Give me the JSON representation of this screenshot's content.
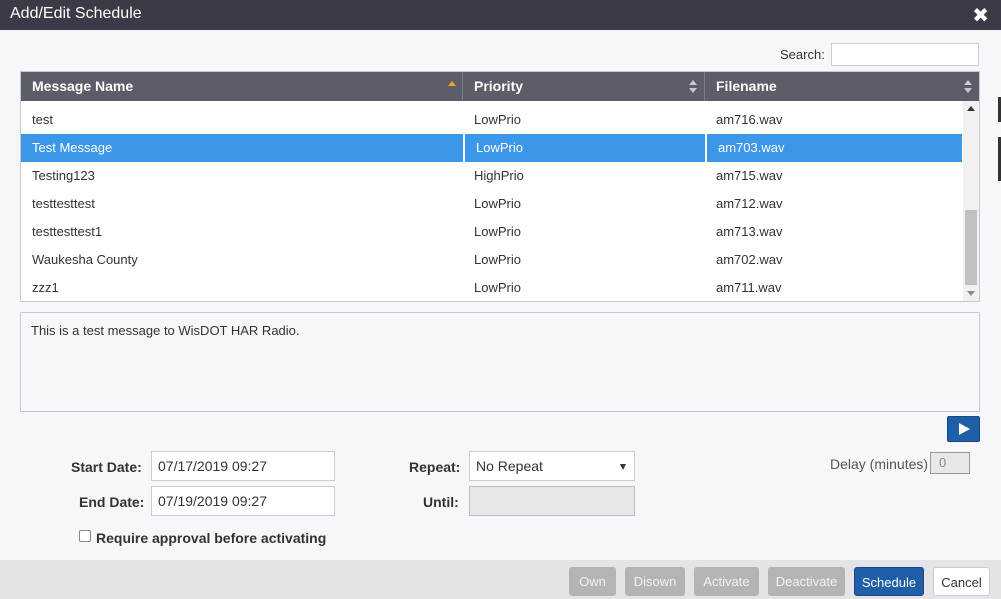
{
  "window": {
    "title": "Add/Edit Schedule"
  },
  "search": {
    "label": "Search:",
    "value": ""
  },
  "table": {
    "columns": [
      "Message Name",
      "Priority",
      "Filename"
    ],
    "rows": [
      {
        "name": "test",
        "priority": "LowPrio",
        "filename": "am716.wav"
      },
      {
        "name": "Test Message",
        "priority": "LowPrio",
        "filename": "am703.wav"
      },
      {
        "name": "Testing123",
        "priority": "HighPrio",
        "filename": "am715.wav"
      },
      {
        "name": "testtesttest",
        "priority": "LowPrio",
        "filename": "am712.wav"
      },
      {
        "name": "testtesttest1",
        "priority": "LowPrio",
        "filename": "am713.wav"
      },
      {
        "name": "Waukesha County",
        "priority": "LowPrio",
        "filename": "am702.wav"
      },
      {
        "name": "zzz1",
        "priority": "LowPrio",
        "filename": "am711.wav"
      }
    ],
    "selected_row": "Test Message"
  },
  "message": {
    "text": "This is a test message to WisDOT HAR Radio."
  },
  "form": {
    "start_date_label": "Start Date:",
    "start_date_value": "07/17/2019 09:27",
    "end_date_label": "End Date:",
    "end_date_value": "07/19/2019 09:27",
    "repeat_label": "Repeat:",
    "repeat_value": "No Repeat",
    "until_label": "Until:",
    "until_value": "",
    "delay_label": "Delay (minutes)",
    "delay_value": "0",
    "approval_label": "Require approval before activating"
  },
  "footer": {
    "own": "Own",
    "disown": "Disown",
    "activate": "Activate",
    "deactivate": "Deactivate",
    "schedule": "Schedule",
    "cancel": "Cancel"
  },
  "colors": {
    "titlebar": "#3a3b46",
    "header": "#5b5d69",
    "selected": "#3c97e8",
    "primary": "#1f5fa8"
  }
}
